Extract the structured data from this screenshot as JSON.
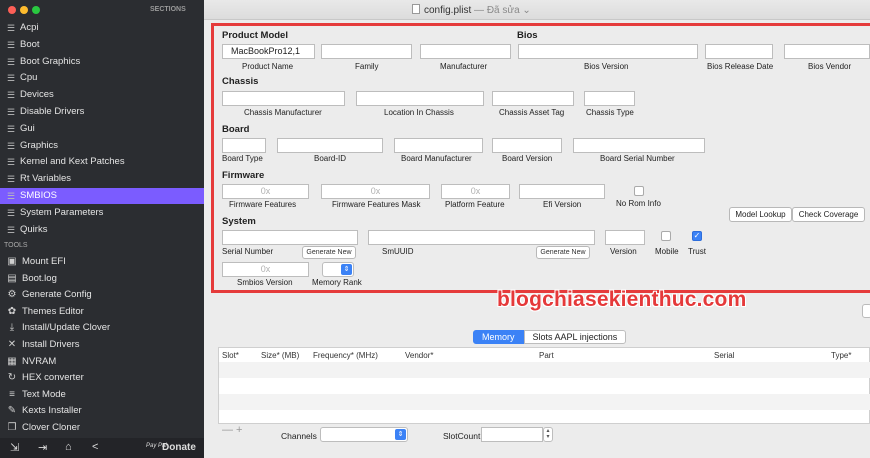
{
  "sidebar": {
    "header": "SECTIONS",
    "items": [
      {
        "label": "Acpi"
      },
      {
        "label": "Boot"
      },
      {
        "label": "Boot Graphics"
      },
      {
        "label": "Cpu"
      },
      {
        "label": "Devices"
      },
      {
        "label": "Disable Drivers"
      },
      {
        "label": "Gui"
      },
      {
        "label": "Graphics"
      },
      {
        "label": "Kernel and Kext Patches"
      },
      {
        "label": "Rt Variables"
      },
      {
        "label": "SMBIOS"
      },
      {
        "label": "System Parameters"
      },
      {
        "label": "Quirks"
      }
    ],
    "selected": "SMBIOS",
    "tools_header": "TOOLS",
    "tools": [
      {
        "label": "Mount EFI",
        "icon": "disk-icon"
      },
      {
        "label": "Boot.log",
        "icon": "log-icon"
      },
      {
        "label": "Generate Config",
        "icon": "gears-icon"
      },
      {
        "label": "Themes Editor",
        "icon": "palette-icon"
      },
      {
        "label": "Install/Update Clover",
        "icon": "download-icon"
      },
      {
        "label": "Install Drivers",
        "icon": "tools-icon"
      },
      {
        "label": "NVRAM",
        "icon": "chip-icon"
      },
      {
        "label": "HEX converter",
        "icon": "refresh-icon"
      },
      {
        "label": "Text Mode",
        "icon": "text-icon"
      },
      {
        "label": "Kexts Installer",
        "icon": "kext-icon"
      },
      {
        "label": "Clover Cloner",
        "icon": "clone-icon"
      }
    ],
    "donate_label": "Donate",
    "paypal_label": "Pay Pal"
  },
  "window": {
    "filename": "config.plist",
    "separator": " — ",
    "status": "Đã sửa"
  },
  "smbios": {
    "product_model_title": "Product Model",
    "bios_title": "Bios",
    "product_name_value": "MacBookPro12,1",
    "labels": {
      "product_name": "Product Name",
      "family": "Family",
      "manufacturer": "Manufacturer",
      "bios_version": "Bios Version",
      "bios_release_date": "Bios Release Date",
      "bios_vendor": "Bios Vendor"
    },
    "chassis_title": "Chassis",
    "chassis_labels": {
      "manufacturer": "Chassis Manufacturer",
      "location": "Location In Chassis",
      "asset_tag": "Chassis  Asset Tag",
      "type": "Chassis Type"
    },
    "board_title": "Board",
    "board_labels": {
      "type": "Board Type",
      "id": "Board-ID",
      "manufacturer": "Board Manufacturer",
      "version": "Board Version",
      "serial": "Board Serial Number"
    },
    "firmware_title": "Firmware",
    "firmware_placeholders": {
      "features": "0x",
      "mask": "0x",
      "platform": "0x"
    },
    "firmware_labels": {
      "features": "Firmware Features",
      "mask": "Firmware Features Mask",
      "platform": "Platform Feature",
      "efi": "Efi Version",
      "no_rom": "No Rom Info"
    },
    "model_lookup": "Model Lookup",
    "check_coverage": "Check Coverage",
    "system_title": "System",
    "system_labels": {
      "serial": "Serial Number",
      "smuuid": "SmUUID",
      "version": "Version",
      "mobile": "Mobile",
      "trust": "Trust",
      "smbios_version": "Smbios Version",
      "memory_rank": "Memory Rank"
    },
    "generate_new_label": "Generate New",
    "smbios_version_placeholder": "0x",
    "mobile_checked": false,
    "trust_checked": true,
    "no_rom_checked": false
  },
  "watermark": "blogchiasekienthuc.com",
  "tabs": [
    {
      "label": "Memory",
      "active": true
    },
    {
      "label": "Slots AAPL injections",
      "active": false
    }
  ],
  "memory_table": {
    "columns": [
      "Slot*",
      "Size* (MB)",
      "Frequency* (MHz)",
      "Vendor*",
      "Part",
      "Serial",
      "Type*"
    ]
  },
  "bottom": {
    "add_remove": "— +",
    "channels_label": "Channels",
    "slotcount_label": "SlotCount"
  },
  "colors": {
    "accent": "#3b82f6",
    "selection": "#7b5cff",
    "highlight_border": "#e53b3b",
    "watermark": "#e5393a"
  }
}
